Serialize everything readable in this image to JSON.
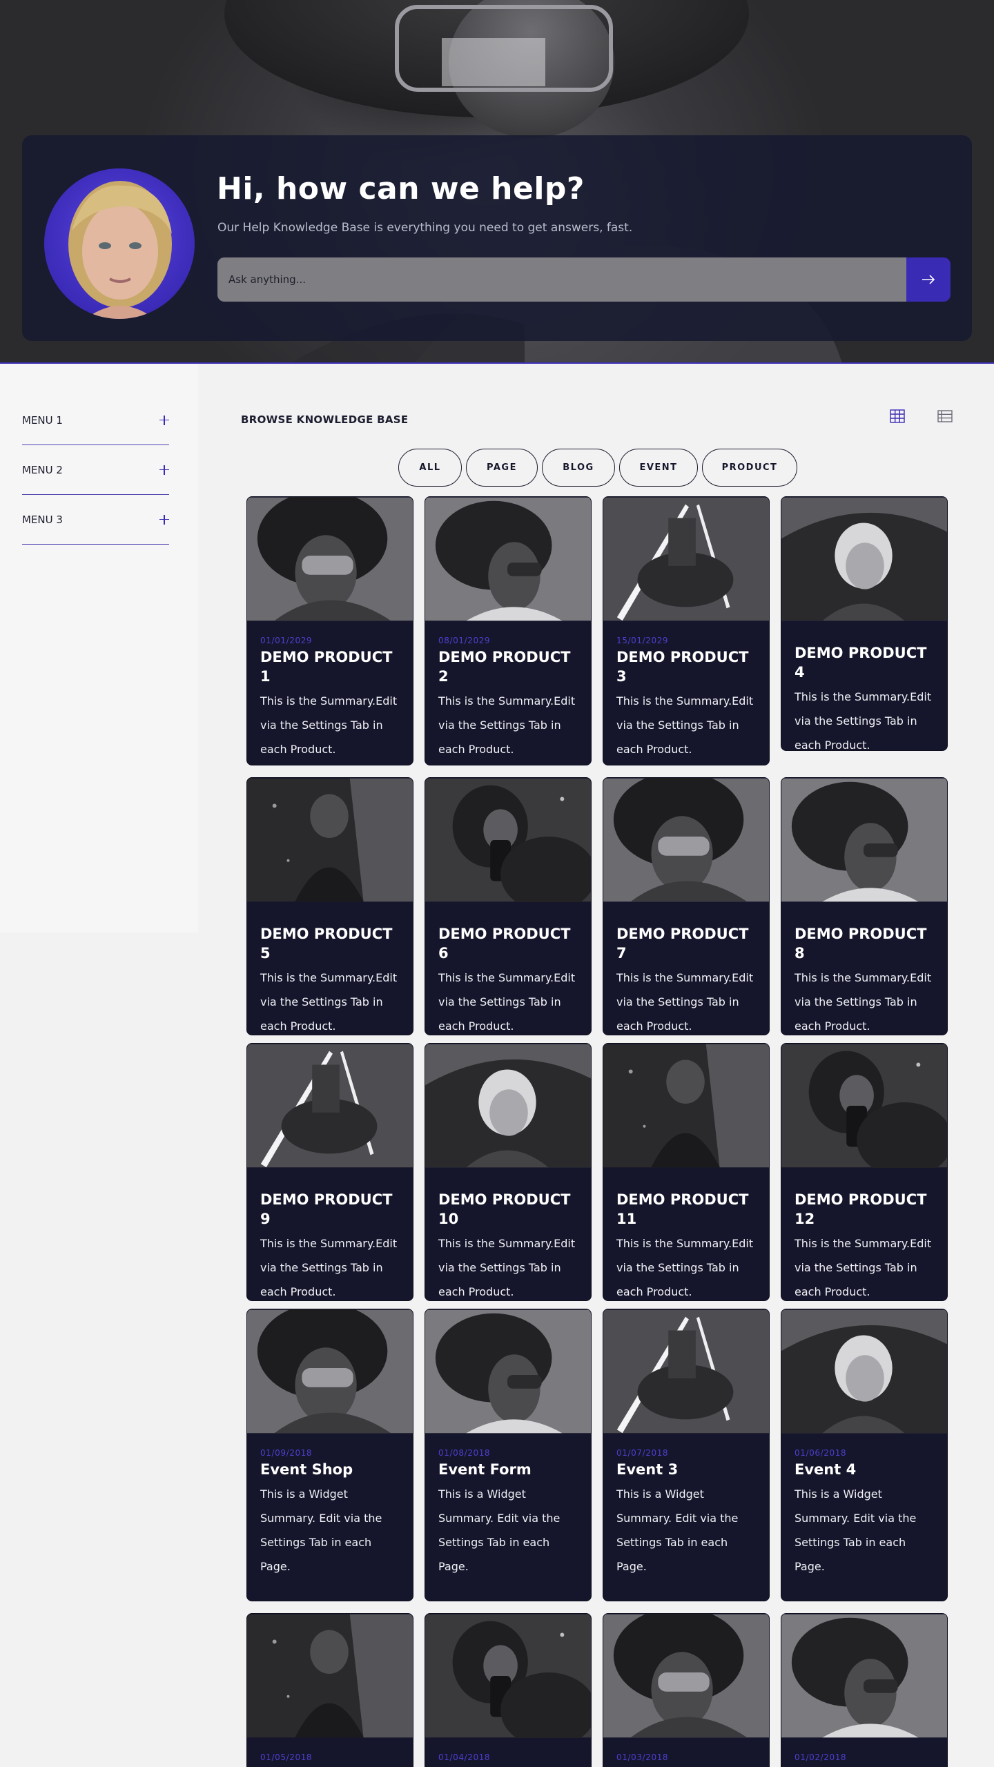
{
  "hero": {
    "title": "Hi, how can we help?",
    "subtitle": "Our Help Knowledge Base is everything you need to get answers, fast.",
    "search_placeholder": "Ask anything..."
  },
  "sidebar": {
    "items": [
      {
        "label": "MENU 1"
      },
      {
        "label": "MENU 2"
      },
      {
        "label": "MENU 3"
      }
    ]
  },
  "browse": {
    "title": "BROWSE KNOWLEDGE BASE",
    "filters": [
      "ALL",
      "PAGE",
      "BLOG",
      "EVENT",
      "PRODUCT"
    ]
  },
  "colors": {
    "accent": "#3a2bb5",
    "card_bg": "#15162b",
    "page_bg": "#f2f2f3"
  },
  "cards": [
    {
      "date": "01/01/2029",
      "title": "DEMO PRODUCT 1",
      "text": "This is the Summary.Edit via the Settings Tab in each Product."
    },
    {
      "date": "08/01/2029",
      "title": "DEMO PRODUCT 2",
      "text": "This is the Summary.Edit via the Settings Tab in each Product."
    },
    {
      "date": "15/01/2029",
      "title": "DEMO PRODUCT 3",
      "text": "This is the Summary.Edit via the Settings Tab in each Product."
    },
    {
      "date": "",
      "title": "DEMO PRODUCT 4",
      "text": "This is the Summary.Edit via the Settings Tab in each Product."
    },
    {
      "date": "",
      "title": "DEMO PRODUCT 5",
      "text": "This is the Summary.Edit via the Settings Tab in each Product."
    },
    {
      "date": "",
      "title": "DEMO PRODUCT 6",
      "text": "This is the Summary.Edit via the Settings Tab in each Product."
    },
    {
      "date": "",
      "title": "DEMO PRODUCT 7",
      "text": "This is the Summary.Edit via the Settings Tab in each Product."
    },
    {
      "date": "",
      "title": "DEMO PRODUCT 8",
      "text": "This is the Summary.Edit via the Settings Tab in each Product."
    },
    {
      "date": "",
      "title": "DEMO PRODUCT 9",
      "text": "This is the Summary.Edit via the Settings Tab in each Product."
    },
    {
      "date": "",
      "title": "DEMO PRODUCT 10",
      "text": "This is the Summary.Edit via the Settings Tab in each Product."
    },
    {
      "date": "",
      "title": "DEMO PRODUCT 11",
      "text": "This is the Summary.Edit via the Settings Tab in each Product."
    },
    {
      "date": "",
      "title": "DEMO PRODUCT 12",
      "text": "This is the Summary.Edit via the Settings Tab in each Product."
    },
    {
      "date": "01/09/2018",
      "title": "Event Shop",
      "text": "This is a Widget Summary. Edit via the Settings Tab in each Page."
    },
    {
      "date": "01/08/2018",
      "title": "Event Form",
      "text": "This is a Widget Summary. Edit via the Settings Tab in each Page."
    },
    {
      "date": "01/07/2018",
      "title": "Event 3",
      "text": "This is a Widget Summary. Edit via the Settings Tab in each Page."
    },
    {
      "date": "01/06/2018",
      "title": "Event 4",
      "text": "This is a Widget Summary. Edit via the Settings Tab in each Page."
    },
    {
      "date": "01/05/2018",
      "title": "",
      "text": ""
    },
    {
      "date": "01/04/2018",
      "title": "",
      "text": ""
    },
    {
      "date": "01/03/2018",
      "title": "",
      "text": ""
    },
    {
      "date": "01/02/2018",
      "title": "",
      "text": ""
    }
  ]
}
